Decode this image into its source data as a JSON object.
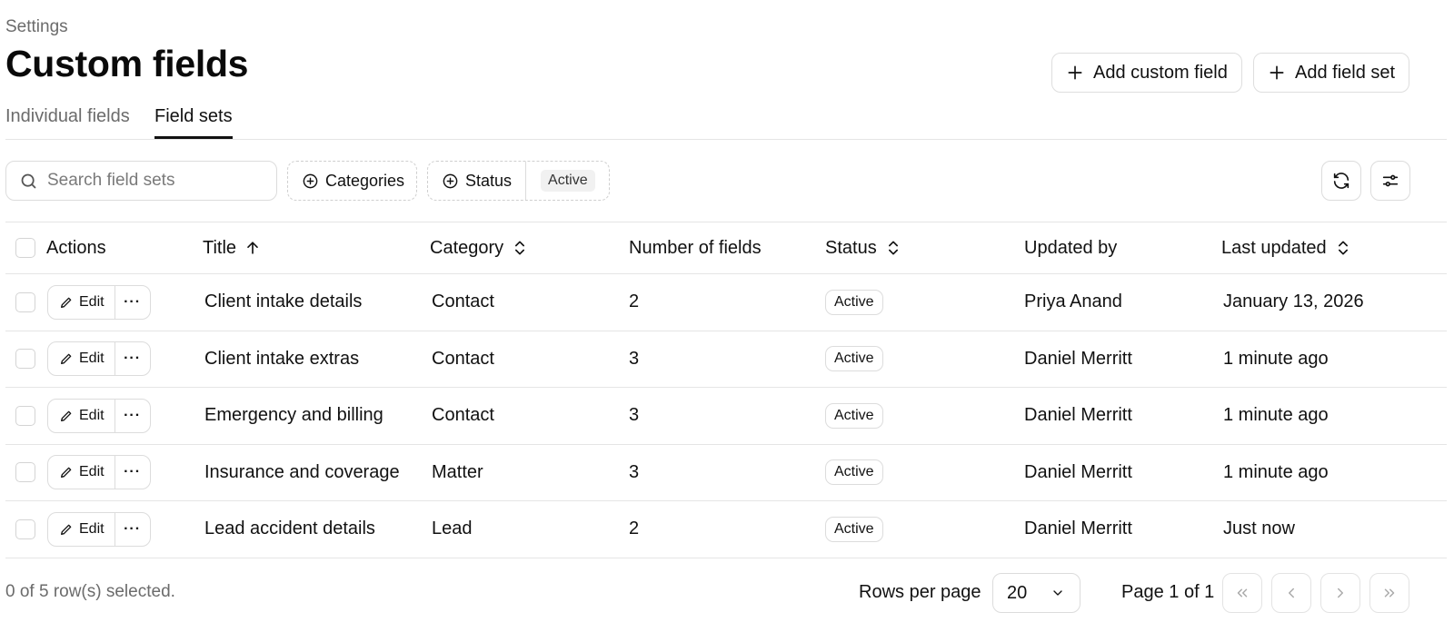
{
  "header": {
    "breadcrumb": "Settings",
    "title": "Custom fields",
    "add_custom_field": "Add custom field",
    "add_field_set": "Add field set"
  },
  "tabs": [
    {
      "label": "Individual fields",
      "active": false
    },
    {
      "label": "Field sets",
      "active": true
    }
  ],
  "toolbar": {
    "search_placeholder": "Search field sets",
    "filter_categories": "Categories",
    "filter_status": "Status",
    "filter_status_value": "Active"
  },
  "table": {
    "columns": {
      "actions": "Actions",
      "title": "Title",
      "category": "Category",
      "number_of_fields": "Number of fields",
      "status": "Status",
      "updated_by": "Updated by",
      "last_updated": "Last updated"
    },
    "edit_label": "Edit",
    "more_label": "···",
    "rows": [
      {
        "title": "Client intake details",
        "category": "Contact",
        "count": "2",
        "status": "Active",
        "updated_by": "Priya Anand",
        "last_updated": "January 13, 2026"
      },
      {
        "title": "Client intake extras",
        "category": "Contact",
        "count": "3",
        "status": "Active",
        "updated_by": "Daniel Merritt",
        "last_updated": "1 minute ago"
      },
      {
        "title": "Emergency and billing",
        "category": "Contact",
        "count": "3",
        "status": "Active",
        "updated_by": "Daniel Merritt",
        "last_updated": "1 minute ago"
      },
      {
        "title": "Insurance and coverage",
        "category": "Matter",
        "count": "3",
        "status": "Active",
        "updated_by": "Daniel Merritt",
        "last_updated": "1 minute ago"
      },
      {
        "title": "Lead accident details",
        "category": "Lead",
        "count": "2",
        "status": "Active",
        "updated_by": "Daniel Merritt",
        "last_updated": "Just now"
      }
    ]
  },
  "footer": {
    "selection": "0 of 5 row(s) selected.",
    "rows_per_page_label": "Rows per page",
    "rows_per_page_value": "20",
    "page_label": "Page 1 of 1"
  },
  "icons": {
    "plus": "plus-icon",
    "search": "search-icon",
    "circle_plus": "circle-plus-icon",
    "refresh": "refresh-icon",
    "settings": "sliders-icon",
    "sort_asc": "arrow-up-icon",
    "sort": "chevrons-up-down-icon",
    "edit": "pencil-icon"
  }
}
